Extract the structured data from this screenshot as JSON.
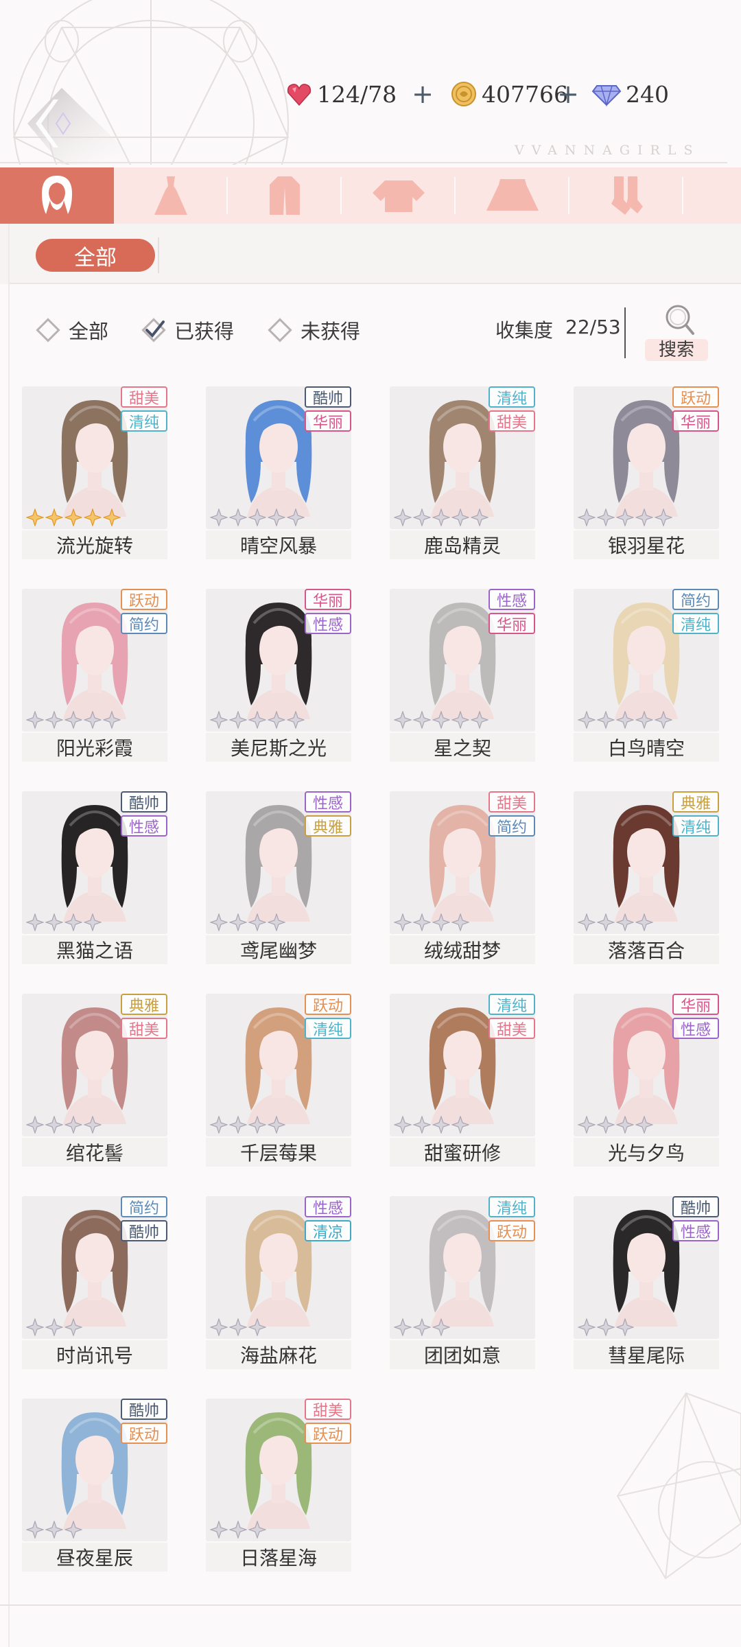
{
  "header": {
    "stamina": "124/78",
    "gold": "407766",
    "diamond": "240",
    "brand": "VVANNAGIRLS"
  },
  "categories": [
    "hair",
    "dress",
    "coat",
    "top",
    "skirt",
    "socks",
    "more"
  ],
  "sub_tabs": {
    "all": "全部"
  },
  "filters": {
    "all": "全部",
    "owned": "已获得",
    "not_owned": "未获得",
    "owned_checked": true
  },
  "collection": {
    "label": "收集度",
    "value": "22/53"
  },
  "search": {
    "label": "搜索"
  },
  "tag_colors": {
    "甜美": "#e5768a",
    "清纯": "#4fb2c8",
    "酷帅": "#4b5a70",
    "华丽": "#d8558a",
    "跃动": "#e58f52",
    "简约": "#5b8ab8",
    "性感": "#9a64c8",
    "典雅": "#c9a040",
    "清凉": "#3fa9c5"
  },
  "items": [
    {
      "name": "流光旋转",
      "tags": [
        "甜美",
        "清纯"
      ],
      "stars": 5,
      "gold": true,
      "hair": "#8c7360"
    },
    {
      "name": "晴空风暴",
      "tags": [
        "酷帅",
        "华丽"
      ],
      "stars": 5,
      "gold": false,
      "hair": "#5c8fd8"
    },
    {
      "name": "鹿岛精灵",
      "tags": [
        "清纯",
        "甜美"
      ],
      "stars": 5,
      "gold": false,
      "hair": "#a08670"
    },
    {
      "name": "银羽星花",
      "tags": [
        "跃动",
        "华丽"
      ],
      "stars": 5,
      "gold": false,
      "hair": "#8e8a98"
    },
    {
      "name": "阳光彩霞",
      "tags": [
        "跃动",
        "简约"
      ],
      "stars": 5,
      "gold": false,
      "hair": "#e7a3b2"
    },
    {
      "name": "美尼斯之光",
      "tags": [
        "华丽",
        "性感"
      ],
      "stars": 5,
      "gold": false,
      "hair": "#2e2a2c"
    },
    {
      "name": "星之契",
      "tags": [
        "性感",
        "华丽"
      ],
      "stars": 5,
      "gold": false,
      "hair": "#bdbaba"
    },
    {
      "name": "白鸟晴空",
      "tags": [
        "简约",
        "清纯"
      ],
      "stars": 5,
      "gold": false,
      "hair": "#e8d6b4"
    },
    {
      "name": "黑猫之语",
      "tags": [
        "酷帅",
        "性感"
      ],
      "stars": 4,
      "gold": false,
      "hair": "#262424"
    },
    {
      "name": "鸢尾幽梦",
      "tags": [
        "性感",
        "典雅"
      ],
      "stars": 4,
      "gold": false,
      "hair": "#aaa7a8"
    },
    {
      "name": "绒绒甜梦",
      "tags": [
        "甜美",
        "简约"
      ],
      "stars": 4,
      "gold": false,
      "hair": "#e2b3a6"
    },
    {
      "name": "落落百合",
      "tags": [
        "典雅",
        "清纯"
      ],
      "stars": 4,
      "gold": false,
      "hair": "#6a3a30"
    },
    {
      "name": "绾花髻",
      "tags": [
        "典雅",
        "甜美"
      ],
      "stars": 4,
      "gold": false,
      "hair": "#c28b8a"
    },
    {
      "name": "千层莓果",
      "tags": [
        "跃动",
        "清纯"
      ],
      "stars": 4,
      "gold": false,
      "hair": "#d3a07d"
    },
    {
      "name": "甜蜜研修",
      "tags": [
        "清纯",
        "甜美"
      ],
      "stars": 4,
      "gold": false,
      "hair": "#b07c5e"
    },
    {
      "name": "光与夕鸟",
      "tags": [
        "华丽",
        "性感"
      ],
      "stars": 4,
      "gold": false,
      "hair": "#e6a2a6"
    },
    {
      "name": "时尚讯号",
      "tags": [
        "简约",
        "酷帅"
      ],
      "stars": 3,
      "gold": false,
      "hair": "#8c6a5c"
    },
    {
      "name": "海盐麻花",
      "tags": [
        "性感",
        "清凉"
      ],
      "stars": 3,
      "gold": false,
      "hair": "#d8bb98"
    },
    {
      "name": "团团如意",
      "tags": [
        "清纯",
        "跃动"
      ],
      "stars": 3,
      "gold": false,
      "hair": "#c2bec0"
    },
    {
      "name": "彗星尾际",
      "tags": [
        "酷帅",
        "性感"
      ],
      "stars": 3,
      "gold": false,
      "hair": "#2a2828"
    },
    {
      "name": "昼夜星辰",
      "tags": [
        "酷帅",
        "跃动"
      ],
      "stars": 3,
      "gold": false,
      "hair": "#90b4d8"
    },
    {
      "name": "日落星海",
      "tags": [
        "甜美",
        "跃动"
      ],
      "stars": 3,
      "gold": false,
      "hair": "#9cb878"
    }
  ]
}
